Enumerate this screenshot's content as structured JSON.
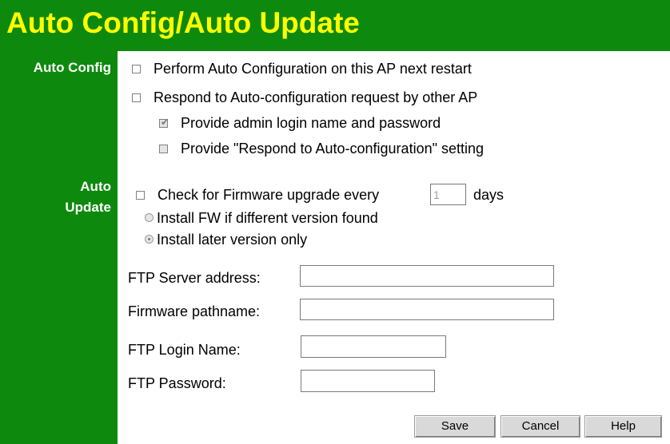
{
  "header": {
    "title": "Auto Config/Auto Update"
  },
  "sidebar": {
    "auto_config_label": "Auto Config",
    "auto_update_label_1": "Auto",
    "auto_update_label_2": "Update"
  },
  "auto_config": {
    "perform_auto_config": {
      "label": "Perform Auto Configuration on this AP next restart",
      "checked": false
    },
    "respond_request": {
      "label": "Respond to Auto-configuration request by other AP",
      "checked": false
    },
    "provide_admin": {
      "label": "Provide admin login name and password",
      "checked": true,
      "disabled": true
    },
    "provide_respond_setting": {
      "label": "Provide \"Respond to Auto-configuration\" setting",
      "checked": false,
      "disabled": true
    }
  },
  "auto_update": {
    "check_firmware_label": "Check for Firmware upgrade every",
    "days_value": "1",
    "days_label": "days",
    "install_if_different": "Install FW if different version found",
    "install_later_only": "Install later version only",
    "selected_option": "Install later version only"
  },
  "ftp": {
    "server_label": "FTP Server address:",
    "server_value": "",
    "pathname_label": "Firmware pathname:",
    "pathname_value": "",
    "login_label": "FTP Login Name:",
    "login_value": "",
    "password_label": "FTP Password:",
    "password_value": ""
  },
  "buttons": {
    "save": "Save",
    "cancel": "Cancel",
    "help": "Help"
  },
  "colors": {
    "header_bg": "#0d8a0d",
    "title_text": "#ffff00",
    "sidebar_bg": "#0d8a0d"
  }
}
